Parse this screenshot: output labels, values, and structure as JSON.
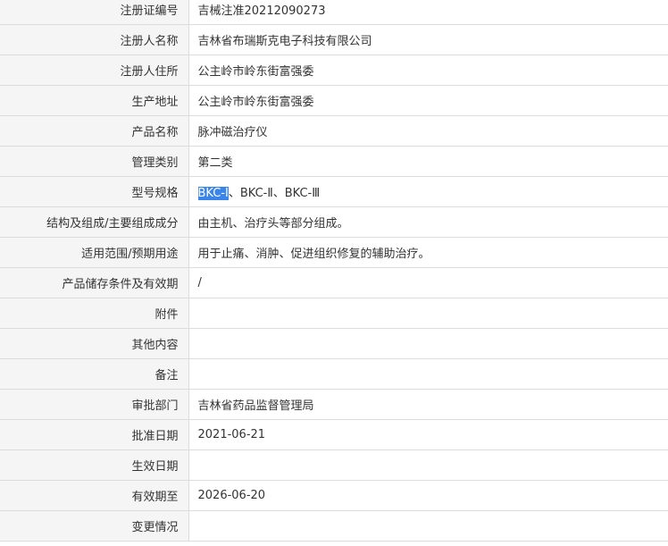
{
  "rows": [
    {
      "label": "注册证编号",
      "value": "吉械注准20212090273"
    },
    {
      "label": "注册人名称",
      "value": "吉林省布瑞斯克电子科技有限公司"
    },
    {
      "label": "注册人住所",
      "value": "公主岭市岭东街富强委"
    },
    {
      "label": "生产地址",
      "value": "公主岭市岭东街富强委"
    },
    {
      "label": "产品名称",
      "value": "脉冲磁治疗仪"
    },
    {
      "label": "管理类别",
      "value": "第二类"
    },
    {
      "label": "型号规格",
      "value_selected": "BKC-Ⅰ",
      "value_rest": "、BKC-Ⅱ、BKC-Ⅲ"
    },
    {
      "label": "结构及组成/主要组成成分",
      "value": "由主机、治疗头等部分组成。"
    },
    {
      "label": "适用范围/预期用途",
      "value": "用于止痛、消肿、促进组织修复的辅助治疗。"
    },
    {
      "label": "产品储存条件及有效期",
      "value": "/"
    },
    {
      "label": "附件",
      "value": ""
    },
    {
      "label": "其他内容",
      "value": ""
    },
    {
      "label": "备注",
      "value": ""
    },
    {
      "label": "审批部门",
      "value": "吉林省药品监督管理局"
    },
    {
      "label": "批准日期",
      "value": "2021-06-21"
    },
    {
      "label": "生效日期",
      "value": ""
    },
    {
      "label": "有效期至",
      "value": "2026-06-20"
    },
    {
      "label": "变更情况",
      "value": ""
    }
  ],
  "colors": {
    "label_bg": "#f5f5f5",
    "border": "#dcdcdc",
    "text": "#333333",
    "selection": "#3b85ea"
  }
}
